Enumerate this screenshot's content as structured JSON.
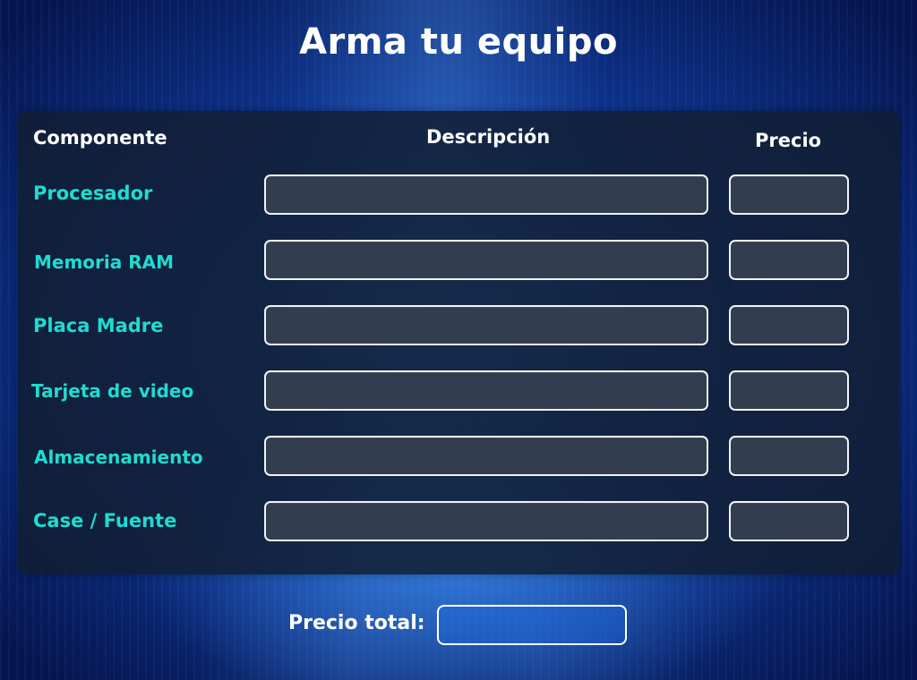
{
  "title": "Arma tu equipo",
  "headers": {
    "component": "Componente",
    "description": "Descripción",
    "price": "Precio"
  },
  "rows": [
    {
      "label": "Procesador",
      "description": "",
      "price": ""
    },
    {
      "label": "Memoria RAM",
      "description": "",
      "price": ""
    },
    {
      "label": "Placa Madre",
      "description": "",
      "price": ""
    },
    {
      "label": "Tarjeta de video",
      "description": "",
      "price": ""
    },
    {
      "label": "Almacenamiento",
      "description": "",
      "price": ""
    },
    {
      "label": "Case / Fuente",
      "description": "",
      "price": ""
    }
  ],
  "total": {
    "label": "Precio total:",
    "value": ""
  },
  "colors": {
    "label_accent": "#1fdcd0",
    "field_fill": "#323d50",
    "panel_fill": "#121e32"
  }
}
